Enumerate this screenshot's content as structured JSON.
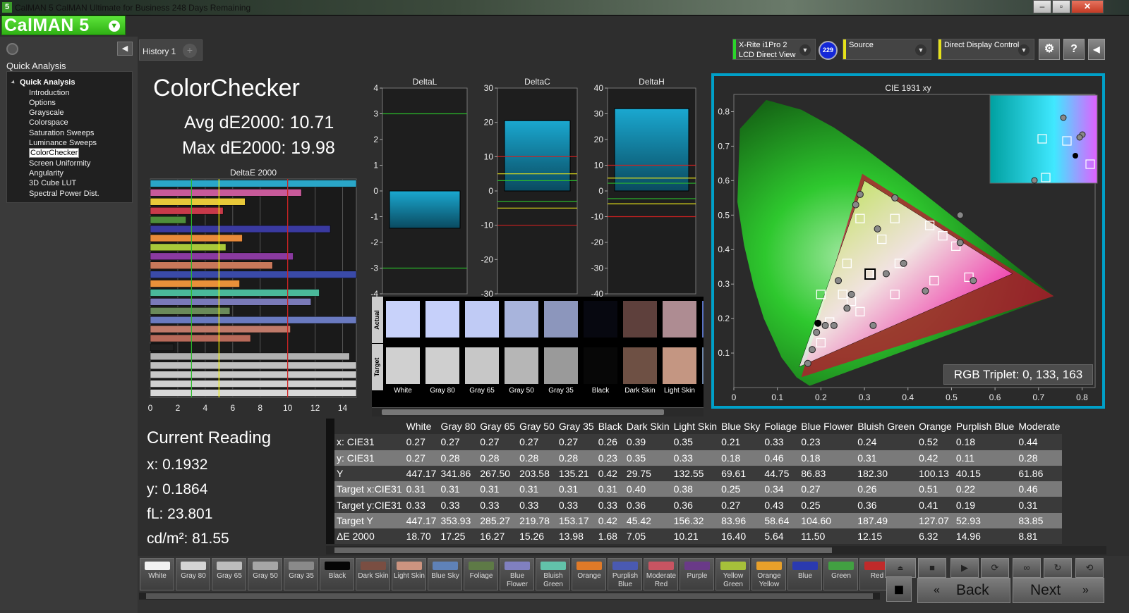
{
  "window": {
    "title": "CalMAN 5 CalMAN Ultimate for Business 248 Days Remaining",
    "app_icon": "5"
  },
  "logo": {
    "text": "CalMAN 5"
  },
  "sidebar": {
    "title": "Quick Analysis",
    "header": "Quick Analysis",
    "items": [
      "Introduction",
      "Options",
      "Grayscale",
      "Colorspace",
      "Saturation Sweeps",
      "Luminance Sweeps",
      "ColorChecker",
      "Screen Uniformity",
      "Angularity",
      "3D Cube LUT",
      "Spectral Power Dist."
    ],
    "selected": "ColorChecker"
  },
  "tabs": {
    "history": "History 1"
  },
  "devices": {
    "meter_line1": "X-Rite i1Pro 2",
    "meter_line2": "LCD Direct View",
    "badge": "229",
    "source": "Source",
    "display": "Direct Display Control"
  },
  "colors": {
    "accent": "#00a0c8",
    "meter": "#2bd52b",
    "source": "#e6e21a",
    "display": "#e6e21a"
  },
  "page": {
    "title": "ColorChecker",
    "avg": "Avg dE2000: 10.71",
    "max": "Max dE2000: 19.98"
  },
  "current_reading": {
    "title": "Current Reading",
    "x": "x: 0.1932",
    "y": "y: 0.1864",
    "fl": "fL: 23.801",
    "cd": "cd/m²: 81.55"
  },
  "swatches": {
    "actual_label": "Actual",
    "target_label": "Target",
    "items": [
      {
        "name": "White",
        "actual": "#c8d2fa",
        "target": "#d0d0d0"
      },
      {
        "name": "Gray 80",
        "actual": "#c6d0fa",
        "target": "#cfcfcf"
      },
      {
        "name": "Gray 65",
        "actual": "#c0cbf5",
        "target": "#c7c7c7"
      },
      {
        "name": "Gray 50",
        "actual": "#a8b4dc",
        "target": "#b6b6b6"
      },
      {
        "name": "Gray 35",
        "actual": "#8c96bc",
        "target": "#9a9a9a"
      },
      {
        "name": "Black",
        "actual": "#070810",
        "target": "#070707"
      },
      {
        "name": "Dark Skin",
        "actual": "#5e403c",
        "target": "#6e5044"
      },
      {
        "name": "Light Skin",
        "actual": "#ae8c92",
        "target": "#c49682"
      },
      {
        "name": "Blue Sky",
        "actual": "#5870c0",
        "target": "#6c84a6"
      }
    ]
  },
  "chart_data": [
    {
      "type": "bar",
      "title": "DeltaE 2000",
      "orientation": "horizontal",
      "xlim": [
        0,
        15
      ],
      "xticks": [
        0,
        2,
        4,
        6,
        8,
        10,
        12,
        14
      ],
      "thresholds": [
        {
          "value": 3,
          "color": "#2bb82b"
        },
        {
          "value": 5,
          "color": "#f0f000"
        },
        {
          "value": 10,
          "color": "#d02020"
        }
      ],
      "bars": [
        {
          "name": "White",
          "value": 18.7,
          "color": "#2aa6c8"
        },
        {
          "name": "Gray 80",
          "value": 11.0,
          "color": "#c85a9a"
        },
        {
          "name": "Gray 65",
          "value": 6.9,
          "color": "#e8c83a"
        },
        {
          "name": "Gray 50",
          "value": 5.3,
          "color": "#c83a4a"
        },
        {
          "name": "Gray 35",
          "value": 2.6,
          "color": "#4e8e3a"
        },
        {
          "name": "Black",
          "value": 13.1,
          "color": "#3a3aa0"
        },
        {
          "name": "Dark Skin",
          "value": 6.7,
          "color": "#e88a3a"
        },
        {
          "name": "Light Skin",
          "value": 5.5,
          "color": "#a8c83a"
        },
        {
          "name": "Blue Sky",
          "value": 10.4,
          "color": "#8a3aa0"
        },
        {
          "name": "Foliage",
          "value": 8.9,
          "color": "#c8785a"
        },
        {
          "name": "Blue Flower",
          "value": 15.4,
          "color": "#3a4aa8"
        },
        {
          "name": "Bluish Green",
          "value": 6.5,
          "color": "#e8903a"
        },
        {
          "name": "Orange",
          "value": 12.3,
          "color": "#4ab89a"
        },
        {
          "name": "Purplish Blue",
          "value": 11.7,
          "color": "#7a7ab8"
        },
        {
          "name": "Moderate Red",
          "value": 5.8,
          "color": "#6a8a5a"
        },
        {
          "name": "Purple",
          "value": 16.5,
          "color": "#6a7ac0"
        },
        {
          "name": "Yellow Green",
          "value": 10.2,
          "color": "#c07a6a"
        },
        {
          "name": "Orange Yellow",
          "value": 7.3,
          "color": "#b86a5a"
        },
        {
          "name": "Blue",
          "value": 1.7,
          "color": "#202020"
        },
        {
          "name": "Green",
          "value": 14.5,
          "color": "#b0b0b0"
        },
        {
          "name": "Red",
          "value": 16.0,
          "color": "#c0c0c0"
        },
        {
          "name": "Yellow",
          "value": 16.0,
          "color": "#c8c8c8"
        },
        {
          "name": "Magenta",
          "value": 16.0,
          "color": "#d0d0d0"
        },
        {
          "name": "Cyan",
          "value": 16.0,
          "color": "#d8d8d8"
        }
      ]
    },
    {
      "type": "bar",
      "title": "DeltaL",
      "ylim": [
        -4,
        4
      ],
      "yticks": [
        -4,
        -3,
        -2,
        -1,
        0,
        1,
        2,
        3,
        4
      ],
      "values": [
        -1.45
      ],
      "lines": [
        {
          "value": 3,
          "color": "#2bb82b"
        },
        {
          "value": -3,
          "color": "#2bb82b"
        }
      ]
    },
    {
      "type": "bar",
      "title": "DeltaC",
      "ylim": [
        -30,
        30
      ],
      "yticks": [
        -30,
        -20,
        -10,
        0,
        10,
        20,
        30
      ],
      "values": [
        20.5
      ],
      "lines": [
        {
          "value": 10,
          "color": "#d02020"
        },
        {
          "value": 5,
          "color": "#e6e21a"
        },
        {
          "value": 3,
          "color": "#2bb82b"
        },
        {
          "value": -3,
          "color": "#2bb82b"
        },
        {
          "value": -5,
          "color": "#e6e21a"
        },
        {
          "value": -10,
          "color": "#d02020"
        }
      ]
    },
    {
      "type": "bar",
      "title": "DeltaH",
      "ylim": [
        -40,
        40
      ],
      "yticks": [
        -40,
        -30,
        -20,
        -10,
        0,
        10,
        20,
        30,
        40
      ],
      "values": [
        32.0
      ],
      "lines": [
        {
          "value": 10,
          "color": "#d02020"
        },
        {
          "value": 5,
          "color": "#e6e21a"
        },
        {
          "value": 3,
          "color": "#2bb82b"
        },
        {
          "value": -3,
          "color": "#2bb82b"
        },
        {
          "value": -5,
          "color": "#e6e21a"
        },
        {
          "value": -10,
          "color": "#d02020"
        }
      ]
    },
    {
      "type": "scatter",
      "title": "CIE 1931 xy",
      "xlim": [
        0,
        0.83
      ],
      "ylim": [
        0,
        0.85
      ],
      "xticks": [
        0,
        0.1,
        0.2,
        0.3,
        0.4,
        0.5,
        0.6,
        0.7,
        0.8
      ],
      "yticks": [
        0.1,
        0.2,
        0.3,
        0.4,
        0.5,
        0.6,
        0.7,
        0.8
      ],
      "gamut": [
        [
          0.64,
          0.33
        ],
        [
          0.3,
          0.6
        ],
        [
          0.15,
          0.06
        ]
      ],
      "native_gamut": [
        [
          0.735,
          0.265
        ],
        [
          0.295,
          0.62
        ],
        [
          0.155,
          0.03
        ]
      ],
      "target_points": [
        [
          0.313,
          0.329
        ],
        [
          0.38,
          0.36
        ],
        [
          0.25,
          0.27
        ],
        [
          0.34,
          0.43
        ],
        [
          0.27,
          0.25
        ],
        [
          0.26,
          0.36
        ],
        [
          0.51,
          0.41
        ],
        [
          0.22,
          0.19
        ],
        [
          0.46,
          0.31
        ],
        [
          0.29,
          0.22
        ],
        [
          0.37,
          0.49
        ],
        [
          0.48,
          0.44
        ],
        [
          0.2,
          0.13
        ],
        [
          0.29,
          0.49
        ],
        [
          0.54,
          0.32
        ],
        [
          0.45,
          0.47
        ],
        [
          0.37,
          0.27
        ],
        [
          0.2,
          0.27
        ],
        [
          0.31,
          0.33
        ]
      ],
      "measured_points": [
        [
          0.27,
          0.27
        ],
        [
          0.26,
          0.23
        ],
        [
          0.39,
          0.36
        ],
        [
          0.35,
          0.33
        ],
        [
          0.21,
          0.18
        ],
        [
          0.33,
          0.46
        ],
        [
          0.23,
          0.18
        ],
        [
          0.24,
          0.31
        ],
        [
          0.52,
          0.42
        ],
        [
          0.18,
          0.11
        ],
        [
          0.44,
          0.28
        ],
        [
          0.17,
          0.07
        ],
        [
          0.29,
          0.56
        ],
        [
          0.52,
          0.5
        ],
        [
          0.55,
          0.31
        ],
        [
          0.28,
          0.53
        ],
        [
          0.32,
          0.18
        ],
        [
          0.19,
          0.16
        ],
        [
          0.37,
          0.55
        ]
      ],
      "current_point": [
        0.1932,
        0.1864
      ]
    }
  ],
  "inset": {
    "label": "RGB Triplet: 0, 133, 163"
  },
  "table": {
    "columns": [
      "",
      "White",
      "Gray 80",
      "Gray 65",
      "Gray 50",
      "Gray 35",
      "Black",
      "Dark Skin",
      "Light Skin",
      "Blue Sky",
      "Foliage",
      "Blue Flower",
      "Bluish Green",
      "Orange",
      "Purplish Blue",
      "Moderate"
    ],
    "rows": [
      [
        "x: CIE31",
        "0.27",
        "0.27",
        "0.27",
        "0.27",
        "0.27",
        "0.26",
        "0.39",
        "0.35",
        "0.21",
        "0.33",
        "0.23",
        "0.24",
        "0.52",
        "0.18",
        "0.44"
      ],
      [
        "y: CIE31",
        "0.27",
        "0.28",
        "0.28",
        "0.28",
        "0.28",
        "0.23",
        "0.35",
        "0.33",
        "0.18",
        "0.46",
        "0.18",
        "0.31",
        "0.42",
        "0.11",
        "0.28"
      ],
      [
        "Y",
        "447.17",
        "341.86",
        "267.50",
        "203.58",
        "135.21",
        "0.42",
        "29.75",
        "132.55",
        "69.61",
        "44.75",
        "86.83",
        "182.30",
        "100.13",
        "40.15",
        "61.86"
      ],
      [
        "Target x:CIE31",
        "0.31",
        "0.31",
        "0.31",
        "0.31",
        "0.31",
        "0.31",
        "0.40",
        "0.38",
        "0.25",
        "0.34",
        "0.27",
        "0.26",
        "0.51",
        "0.22",
        "0.46"
      ],
      [
        "Target y:CIE31",
        "0.33",
        "0.33",
        "0.33",
        "0.33",
        "0.33",
        "0.33",
        "0.36",
        "0.36",
        "0.27",
        "0.43",
        "0.25",
        "0.36",
        "0.41",
        "0.19",
        "0.31"
      ],
      [
        "Target Y",
        "447.17",
        "353.93",
        "285.27",
        "219.78",
        "153.17",
        "0.42",
        "45.42",
        "156.32",
        "83.96",
        "58.64",
        "104.60",
        "187.49",
        "127.07",
        "52.93",
        "83.85"
      ],
      [
        "ΔE 2000",
        "18.70",
        "17.25",
        "16.27",
        "15.26",
        "13.98",
        "1.68",
        "7.05",
        "10.21",
        "16.40",
        "5.64",
        "11.50",
        "12.15",
        "6.32",
        "14.96",
        "8.81"
      ]
    ]
  },
  "patches": [
    {
      "name": "White",
      "color": "#f2f2f2"
    },
    {
      "name": "Gray 80",
      "color": "#d4d4d4"
    },
    {
      "name": "Gray 65",
      "color": "#bdbdbd"
    },
    {
      "name": "Gray 50",
      "color": "#a6a6a6"
    },
    {
      "name": "Gray 35",
      "color": "#8a8a8a"
    },
    {
      "name": "Black",
      "color": "#050505"
    },
    {
      "name": "Dark Skin",
      "color": "#7a4e42"
    },
    {
      "name": "Light Skin",
      "color": "#cc9480"
    },
    {
      "name": "Blue Sky",
      "color": "#5f82b8"
    },
    {
      "name": "Foliage",
      "color": "#5e7a46"
    },
    {
      "name": "Blue Flower",
      "color": "#8080c0"
    },
    {
      "name": "Bluish Green",
      "color": "#62c2aa"
    },
    {
      "name": "Orange",
      "color": "#e07a28"
    },
    {
      "name": "Purplish Blue",
      "color": "#4a5ab2"
    },
    {
      "name": "Moderate Red",
      "color": "#c85462"
    },
    {
      "name": "Purple",
      "color": "#6a3a88"
    },
    {
      "name": "Yellow Green",
      "color": "#a6c03a"
    },
    {
      "name": "Orange Yellow",
      "color": "#e8a02a"
    },
    {
      "name": "Blue",
      "color": "#2a3ab0"
    },
    {
      "name": "Green",
      "color": "#42a042"
    },
    {
      "name": "Red",
      "color": "#c02a2a"
    }
  ],
  "controls": {
    "back": "Back",
    "next": "Next",
    "window_buttons": [
      "‒",
      "▫",
      "✕"
    ],
    "icons": [
      "record-icon",
      "stop-icon",
      "play-icon",
      "loop-icon",
      "infinite-icon",
      "refresh-icon",
      "settings-icon",
      "help-icon"
    ]
  }
}
